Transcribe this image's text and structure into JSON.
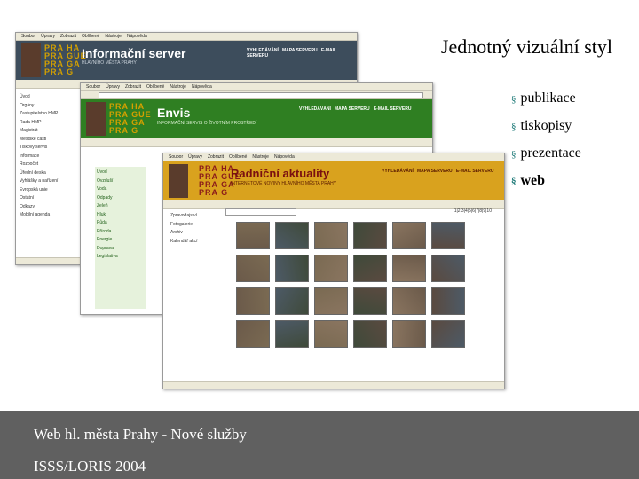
{
  "slide": {
    "title": "Jednotný vizuální styl",
    "bullets": [
      "publikace",
      "tiskopisy",
      "prezentace",
      "web"
    ],
    "bullet_glyph": "§"
  },
  "footer": {
    "line1": "Web hl. města Prahy - Nové služby",
    "line2": "ISSS/LORIS 2004"
  },
  "windows": {
    "info": {
      "menu": [
        "Soubor",
        "Úpravy",
        "Zobrazit",
        "Oblíbené",
        "Nástroje",
        "Nápověda"
      ],
      "logo": [
        "PRA HA",
        "PRA GUE",
        "PRA GA",
        "PRA G"
      ],
      "name": "Informační server",
      "subtitle": "HLAVNÍHO MĚSTA PRAHY",
      "nav": [
        "VYHLEDÁVÁNÍ",
        "MAPA SERVERU",
        "E-MAIL SERVERU"
      ],
      "sidebar": [
        "Úvod",
        "Orgány",
        "Zastupitelstvo HMP",
        "Rada HMP",
        "Magistrát",
        "Městské části",
        "Tiskový servis",
        "Informace",
        "Rozpočet",
        "Úřední deska",
        "Vyhlášky a nařízení",
        "Evropská unie",
        "Ostatní",
        "Odkazy",
        "Mobilní agenda"
      ]
    },
    "envis": {
      "menu": [
        "Soubor",
        "Úpravy",
        "Zobrazit",
        "Oblíbené",
        "Nástroje",
        "Nápověda"
      ],
      "logo": [
        "PRA HA",
        "PRA GUE",
        "PRA GA",
        "PRA G"
      ],
      "name": "Envis",
      "subtitle": "INFORMAČNÍ SERVIS O ŽIVOTNÍM PROSTŘEDÍ",
      "nav": [
        "VYHLEDÁVÁNÍ",
        "MAPA SERVERU",
        "E-MAIL SERVERU"
      ],
      "sidebar": [
        "Úvod",
        "Ovzduší",
        "Voda",
        "Odpady",
        "Zeleň",
        "Hluk",
        "Půda",
        "Příroda",
        "Energie",
        "Doprava",
        "Legislativa"
      ]
    },
    "radnicni": {
      "menu": [
        "Soubor",
        "Úpravy",
        "Zobrazit",
        "Oblíbené",
        "Nástroje",
        "Nápověda"
      ],
      "logo": [
        "PRA HA",
        "PRA GUE",
        "PRA GA",
        "PRA G"
      ],
      "name": "Radniční aktuality",
      "subtitle": "INTERNETOVÉ NOVINY HLAVNÍHO MĚSTA PRAHY",
      "nav": [
        "VYHLEDÁVÁNÍ",
        "MAPA SERVERU",
        "E-MAIL SERVERU"
      ],
      "sidebar": [
        "Zpravodajství",
        "Fotogalerie",
        "Archiv",
        "Kalendář akcí"
      ],
      "pages": "1|2|3|4|5|6|7|8|9|10"
    }
  },
  "colors": {
    "footer_bg": "#606060",
    "info_header": "#3d4d5c",
    "envis_header": "#2f7f22",
    "radnicni_header": "#d9a21e",
    "envis_accent": "#2e8b2e",
    "bullet": "#1e7a78"
  }
}
